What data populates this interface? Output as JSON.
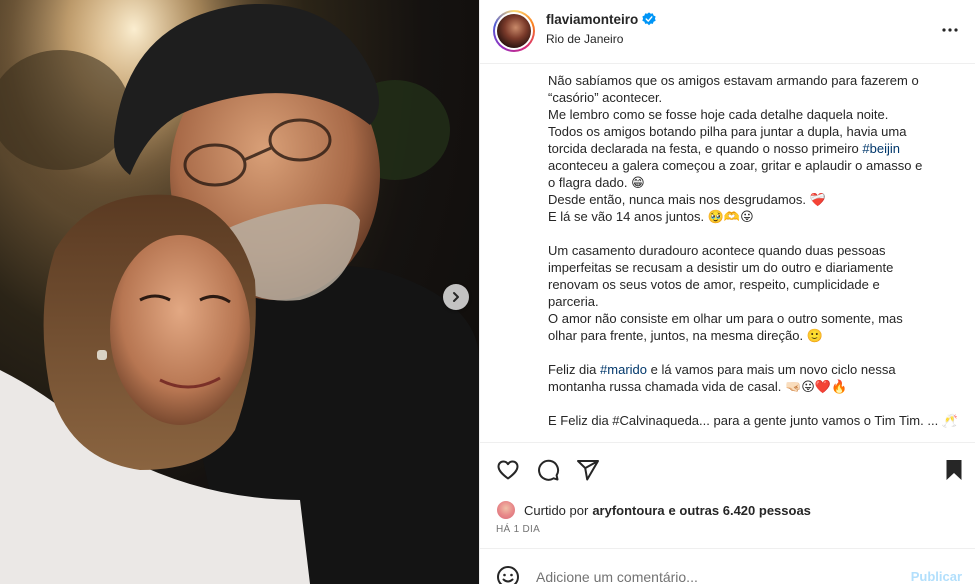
{
  "post": {
    "username": "flaviamonteiro",
    "location": "Rio de Janeiro",
    "caption_lines": [
      "Não sabíamos que os amigos estavam armando para fazerem o",
      "“casório” acontecer.",
      "Me lembro como se fosse hoje cada detalhe daquela noite.",
      "Todos os amigos botando pilha para juntar a dupla, havia uma",
      "torcida declarada na festa, e quando o nosso primeiro ",
      "aconteceu a galera começou a zoar, gritar e aplaudir o amasso e",
      "o flagra dado. 😁",
      "Desde então, nunca mais nos desgrudamos. ❤️‍🩹",
      "E lá se vão 14 anos juntos. 🥹🫶😛",
      "",
      "Um casamento duradouro acontece quando duas pessoas",
      "imperfeitas se recusam a desistir um do outro e diariamente",
      "renovam os seus votos de amor, respeito, cumplicidade e",
      "parceria.",
      "O amor não consiste em olhar um para o outro somente, mas",
      "olhar para frente, juntos, na mesma direção. 🙂",
      "",
      "Feliz dia ",
      "montanha russa chamada vida de casal. 🤜🏻😛❤️🔥",
      "",
      "E Feliz dia #Calvinaqueda... para a gente junto vamos o Tim Tim. ... 🥂"
    ],
    "hashtag_beijin": "#beijin",
    "hashtag_marido": "#marido",
    "marido_tail": " e lá vamos para mais um novo ciclo nessa",
    "liked_prefix": "Curtido por",
    "liked_user": "aryfontoura",
    "liked_suffix": "e outras 6.420 pessoas",
    "timestamp": "HÁ 1 DIA",
    "comment_placeholder": "Adicione um comentário...",
    "post_label": "Publicar"
  },
  "icons": {
    "verified": "verified-badge-icon",
    "more": "more-options-icon",
    "like": "heart-icon",
    "comment": "comment-icon",
    "share": "share-icon",
    "save": "bookmark-icon",
    "emoji": "emoji-icon",
    "carousel_next": "chevron-right-icon"
  },
  "colors": {
    "verified_blue": "#0095f6",
    "hashtag": "#00376b",
    "post_button_disabled": "#b2dffc"
  }
}
